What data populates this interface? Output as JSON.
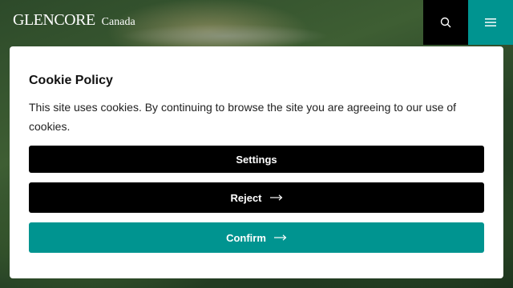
{
  "header": {
    "logo_word": "GLENCORE",
    "logo_region": "Canada",
    "search_icon": "search-icon",
    "menu_icon": "hamburger-menu-icon"
  },
  "cookie_modal": {
    "title": "Cookie Policy",
    "body": "This site uses cookies. By continuing to browse the site you are agreeing to our use of cookies.",
    "settings_label": "Settings",
    "reject_label": "Reject",
    "confirm_label": "Confirm",
    "arrow_icon": "arrow-right-icon"
  },
  "colors": {
    "accent_teal": "#009490",
    "button_black": "#000000",
    "modal_bg": "#ffffff"
  }
}
